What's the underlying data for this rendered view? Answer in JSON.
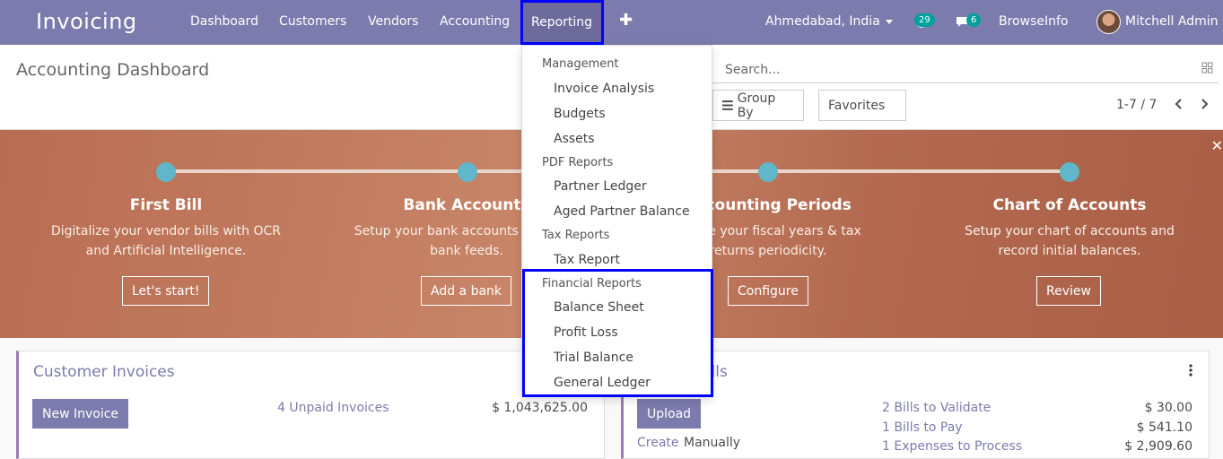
{
  "navbar": {
    "app_title": "Invoicing",
    "items": [
      "Dashboard",
      "Customers",
      "Vendors",
      "Accounting"
    ],
    "active_item": "Reporting",
    "company": "Ahmedabad, India",
    "activity_count": "29",
    "message_count": "6",
    "browse_info": "BrowseInfo",
    "user": "Mitchell Admin"
  },
  "control_panel": {
    "title": "Accounting Dashboard",
    "search_placeholder": "Search...",
    "group_by": "Group By",
    "favorites": "Favorites",
    "pager": "1-7 / 7"
  },
  "banner": {
    "steps": [
      {
        "title": "First Bill",
        "desc": "Digitalize your vendor bills with OCR and Artificial Intelligence.",
        "button": "Let's start!"
      },
      {
        "title": "Bank Accounts",
        "desc": "Setup your bank accounts and sync bank feeds.",
        "button": "Add a bank"
      },
      {
        "title": "Accounting Periods",
        "desc": "Define your fiscal years & tax returns periodicity.",
        "button": "Configure"
      },
      {
        "title": "Chart of Accounts",
        "desc": "Setup your chart of accounts and record initial balances.",
        "button": "Review"
      }
    ]
  },
  "cards": {
    "customer": {
      "title": "Customer Invoices",
      "button": "New Invoice",
      "unpaid_label": "4 Unpaid Invoices",
      "unpaid_amount": "$ 1,043,625.00"
    },
    "vendor": {
      "title": "Vendor Bills",
      "button": "Upload",
      "create_link": "Create",
      "create_text": "Manually",
      "rows": [
        {
          "label": "2 Bills to Validate",
          "amount": "$ 30.00"
        },
        {
          "label": "1 Bills to Pay",
          "amount": "$ 541.10"
        },
        {
          "label": "1 Expenses to Process",
          "amount": "$ 2,909.60"
        }
      ]
    }
  },
  "reporting_menu": {
    "sections": [
      {
        "header": "Management",
        "items": [
          "Invoice Analysis",
          "Budgets",
          "Assets"
        ]
      },
      {
        "header": "PDF Reports",
        "items": [
          "Partner Ledger",
          "Aged Partner Balance"
        ]
      },
      {
        "header": "Tax Reports",
        "items": [
          "Tax Report"
        ]
      },
      {
        "header": "Financial Reports",
        "items": [
          "Balance Sheet",
          "Profit Loss",
          "Trial Balance",
          "General Ledger"
        ]
      }
    ]
  },
  "colors": {
    "brand": "#7c7bad",
    "highlight": "#0000ff",
    "badge": "#00a09d"
  }
}
